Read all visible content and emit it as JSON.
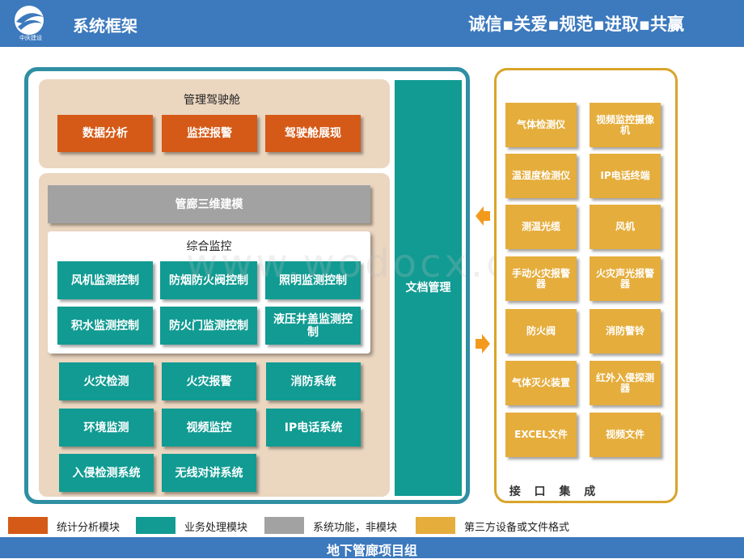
{
  "header": {
    "logo_text": "中庆建设",
    "title": "系统框架",
    "slogan": "诚信▪关爱▪规范▪进取▪共赢"
  },
  "cockpit": {
    "title": "管理驾驶舱",
    "items": [
      "数据分析",
      "监控报警",
      "驾驶舱展现"
    ]
  },
  "modeling": {
    "label": "管廊三维建模"
  },
  "monitoring": {
    "title": "综合监控",
    "items": [
      "风机监测控制",
      "防烟防火阀控制",
      "照明监测控制",
      "积水监测控制",
      "防火门监测控制",
      "液压井盖监测控制"
    ]
  },
  "business": {
    "items": [
      "火灾检测",
      "火灾报警",
      "消防系统",
      "环境监测",
      "视频监控",
      "IP电话系统",
      "入侵检测系统",
      "无线对讲系统"
    ]
  },
  "doc_management": {
    "label": "文档管理"
  },
  "interface": {
    "title": "接 口 集 成",
    "items": [
      "气体检测仪",
      "视频监控摄像机",
      "温湿度检测仪",
      "IP电话终端",
      "测温光缆",
      "风机",
      "手动火灾报警器",
      "火灾声光报警器",
      "防火阀",
      "消防警铃",
      "气体灭火装置",
      "红外入侵探测器",
      "EXCEL文件",
      "视频文件"
    ]
  },
  "legend": [
    {
      "label": "统计分析模块",
      "color": "#d55a17"
    },
    {
      "label": "业务处理模块",
      "color": "#119b92"
    },
    {
      "label": "系统功能，非模块",
      "color": "#a2a2a2"
    },
    {
      "label": "第三方设备或文件格式",
      "color": "#e5ad3c"
    }
  ],
  "footer": {
    "text": "地下管廊项目组"
  },
  "watermark": "www.wodocx.com"
}
